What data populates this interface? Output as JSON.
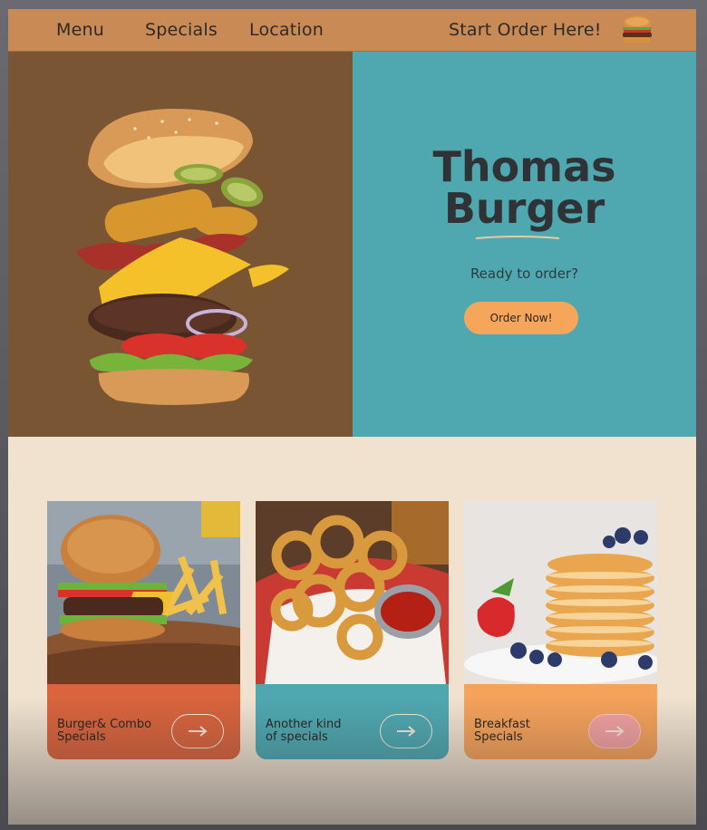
{
  "nav": {
    "menu": "Menu",
    "specials": "Specials",
    "location": "Location",
    "start_order": "Start Order Here!",
    "icon": "burger-icon"
  },
  "hero": {
    "title_line1": "Thomas",
    "title_line2": "Burger",
    "subtitle": "Ready to order?",
    "button": "Order Now!",
    "image": "floating-burger-image"
  },
  "cards": [
    {
      "label_line1": "Burger& Combo",
      "label_line2": "Specials",
      "image": "burger-fries-photo",
      "icon": "arrow-right-icon"
    },
    {
      "label_line1": "Another kind",
      "label_line2": "of specials",
      "image": "onion-rings-photo",
      "icon": "arrow-right-icon"
    },
    {
      "label_line1": "Breakfast",
      "label_line2": "Specials",
      "image": "pancakes-photo",
      "icon": "arrow-right-icon"
    }
  ],
  "colors": {
    "nav": "#c98a56",
    "hero_left": "#7a5533",
    "hero_right": "#4fa8b0",
    "accent_orange": "#f6a65a",
    "card_red": "#d9643d",
    "card_teal": "#4fa8b0",
    "card_orange": "#f5a25a",
    "page_bg": "#f1e2cf"
  }
}
